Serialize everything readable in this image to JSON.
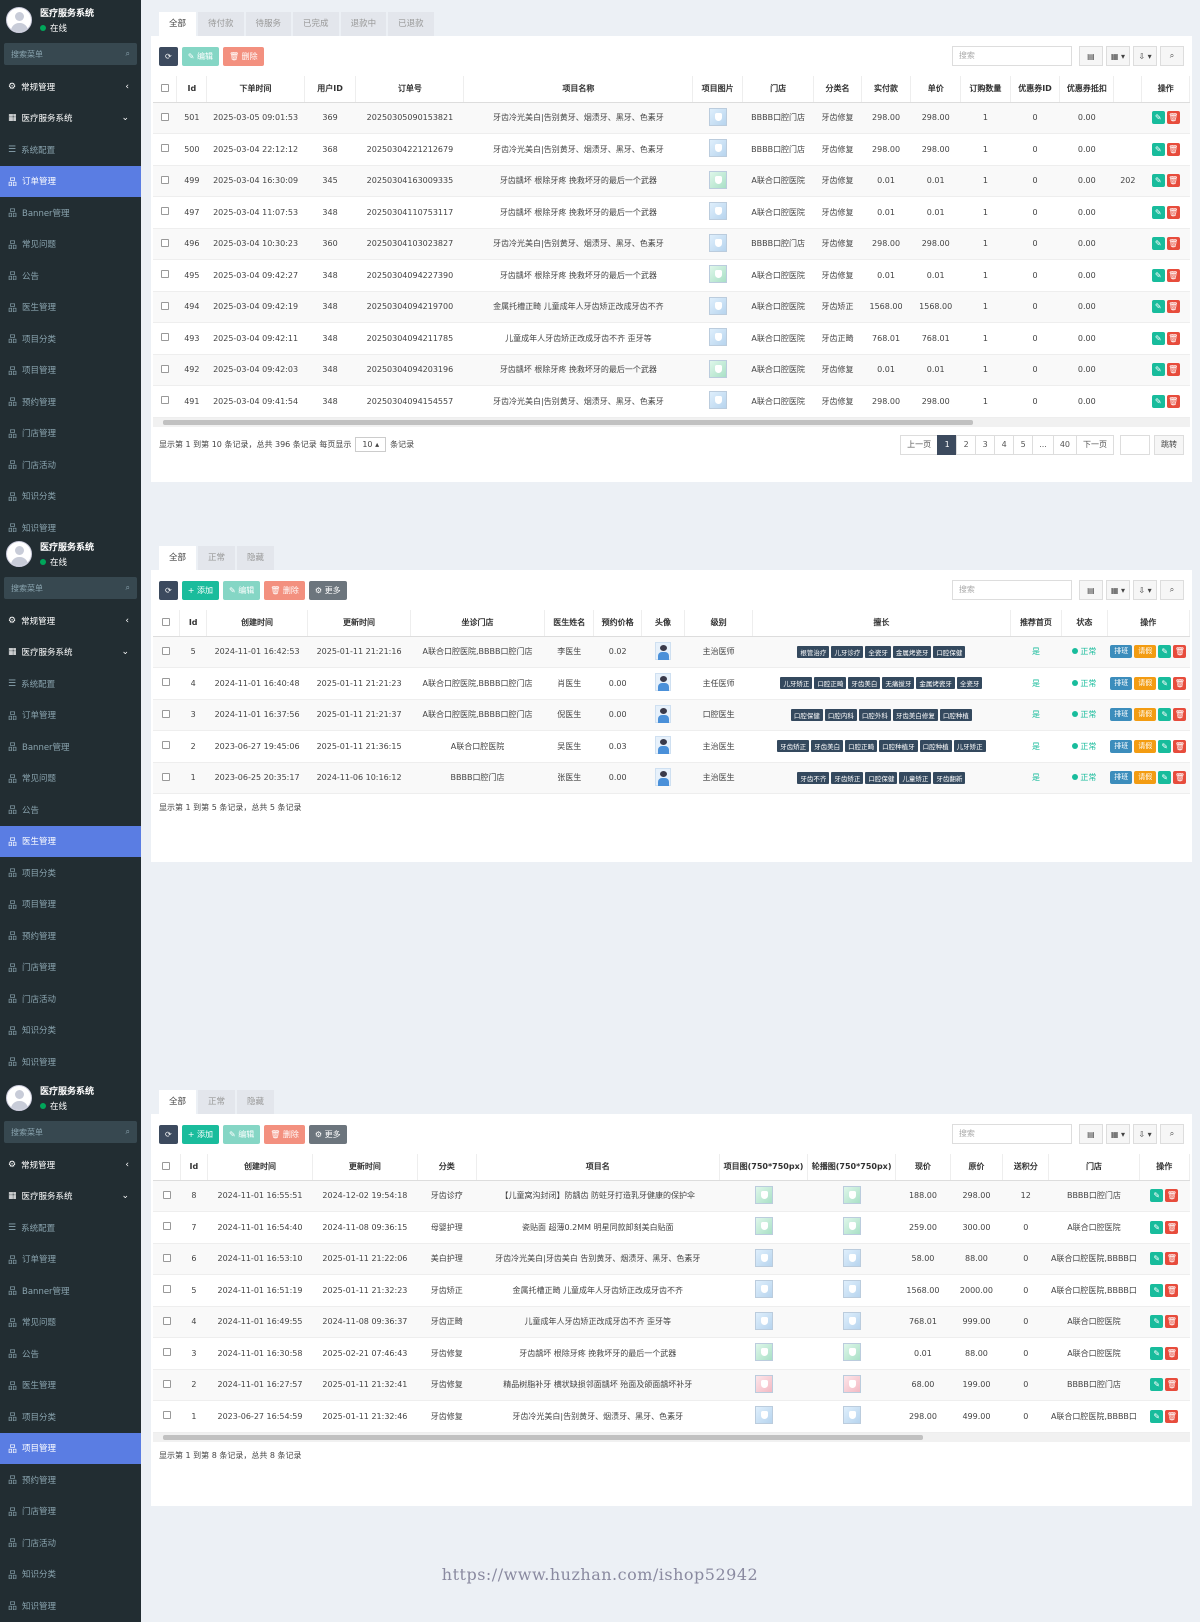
{
  "sidebar": {
    "user_name": "医疗服务系统",
    "user_status": "在线",
    "search_placeholder": "搜索菜单",
    "items": [
      {
        "label": "常规管理",
        "type": "top",
        "arrow": "‹"
      },
      {
        "label": "医疗服务系统",
        "type": "top",
        "arrow": "⌄"
      },
      {
        "label": "系统配置",
        "type": "sub"
      },
      {
        "label": "订单管理",
        "type": "sub"
      },
      {
        "label": "Banner管理",
        "type": "sub"
      },
      {
        "label": "常见问题",
        "type": "sub"
      },
      {
        "label": "公告",
        "type": "sub"
      },
      {
        "label": "医生管理",
        "type": "sub"
      },
      {
        "label": "项目分类",
        "type": "sub"
      },
      {
        "label": "项目管理",
        "type": "sub"
      },
      {
        "label": "预约管理",
        "type": "sub"
      },
      {
        "label": "门店管理",
        "type": "sub"
      },
      {
        "label": "门店活动",
        "type": "sub"
      },
      {
        "label": "知识分类",
        "type": "sub"
      },
      {
        "label": "知识管理",
        "type": "sub"
      }
    ]
  },
  "common": {
    "search_placeholder": "搜索",
    "btn_edit": "编辑",
    "btn_delete": "删除",
    "btn_add": "添加",
    "btn_more": "更多"
  },
  "orders": {
    "active_menu": 3,
    "tabs": [
      "全部",
      "待付款",
      "待服务",
      "已完成",
      "退款中",
      "已退款"
    ],
    "headers": [
      "Id",
      "下单时间",
      "用户ID",
      "订单号",
      "项目名称",
      "项目图片",
      "门店",
      "分类名",
      "实付款",
      "单价",
      "订购数量",
      "优惠券ID",
      "优惠券抵扣",
      "",
      "操作"
    ],
    "rows": [
      [
        "501",
        "2025-03-05 09:01:53",
        "369",
        "20250305090153821",
        "牙齿冷光美白|告别黄牙、烟渍牙、黑牙、色素牙",
        "BBBB口腔门店",
        "牙齿修复",
        "298.00",
        "298.00",
        "1",
        "0",
        "0.00",
        ""
      ],
      [
        "500",
        "2025-03-04 22:12:12",
        "368",
        "20250304221212679",
        "牙齿冷光美白|告别黄牙、烟渍牙、黑牙、色素牙",
        "BBBB口腔门店",
        "牙齿修复",
        "298.00",
        "298.00",
        "1",
        "0",
        "0.00",
        ""
      ],
      [
        "499",
        "2025-03-04 16:30:09",
        "345",
        "20250304163009335",
        "牙齿龋坏 根除牙疼 挽救坏牙的最后一个武器",
        "A联合口腔医院",
        "牙齿修复",
        "0.01",
        "0.01",
        "1",
        "0",
        "0.00",
        "202"
      ],
      [
        "497",
        "2025-03-04 11:07:53",
        "348",
        "20250304110753117",
        "牙齿龋坏 根除牙疼 挽救坏牙的最后一个武器",
        "A联合口腔医院",
        "牙齿修复",
        "0.01",
        "0.01",
        "1",
        "0",
        "0.00",
        ""
      ],
      [
        "496",
        "2025-03-04 10:30:23",
        "360",
        "20250304103023827",
        "牙齿冷光美白|告别黄牙、烟渍牙、黑牙、色素牙",
        "BBBB口腔门店",
        "牙齿修复",
        "298.00",
        "298.00",
        "1",
        "0",
        "0.00",
        ""
      ],
      [
        "495",
        "2025-03-04 09:42:27",
        "348",
        "20250304094227390",
        "牙齿龋坏 根除牙疼 挽救坏牙的最后一个武器",
        "A联合口腔医院",
        "牙齿修复",
        "0.01",
        "0.01",
        "1",
        "0",
        "0.00",
        ""
      ],
      [
        "494",
        "2025-03-04 09:42:19",
        "348",
        "20250304094219700",
        "金属托槽正畸 儿童成年人牙齿矫正改成牙齿不齐",
        "A联合口腔医院",
        "牙齿矫正",
        "1568.00",
        "1568.00",
        "1",
        "0",
        "0.00",
        ""
      ],
      [
        "493",
        "2025-03-04 09:42:11",
        "348",
        "20250304094211785",
        "儿童成年人牙齿矫正改成牙齿不齐 歪牙等",
        "A联合口腔医院",
        "牙齿正畸",
        "768.01",
        "768.01",
        "1",
        "0",
        "0.00",
        ""
      ],
      [
        "492",
        "2025-03-04 09:42:03",
        "348",
        "20250304094203196",
        "牙齿龋坏 根除牙疼 挽救坏牙的最后一个武器",
        "A联合口腔医院",
        "牙齿修复",
        "0.01",
        "0.01",
        "1",
        "0",
        "0.00",
        ""
      ],
      [
        "491",
        "2025-03-04 09:41:54",
        "348",
        "20250304094154557",
        "牙齿冷光美白|告别黄牙、烟渍牙、黑牙、色素牙",
        "A联合口腔医院",
        "牙齿修复",
        "298.00",
        "298.00",
        "1",
        "0",
        "0.00",
        ""
      ]
    ],
    "pager_info": "显示第 1 到第 10 条记录，总共 396 条记录 每页显示",
    "page_size": "10",
    "page_size_suffix": "条记录",
    "prev": "上一页",
    "pages": [
      "1",
      "2",
      "3",
      "4",
      "5",
      "...",
      "40"
    ],
    "next": "下一页",
    "jump": "跳转"
  },
  "doctors": {
    "active_menu": 7,
    "tabs": [
      "全部",
      "正常",
      "隐藏"
    ],
    "headers": [
      "Id",
      "创建时间",
      "更新时间",
      "坐诊门店",
      "医生姓名",
      "预约价格",
      "头像",
      "级别",
      "擅长",
      "推荐首页",
      "状态",
      "操作"
    ],
    "rows": [
      {
        "id": "5",
        "created": "2024-11-01 16:42:53",
        "updated": "2025-01-11 21:21:16",
        "store": "A联合口腔医院,BBBB口腔门店",
        "name": "李医生",
        "price": "0.02",
        "level": "主治医师",
        "tags": [
          "根管治疗",
          "儿牙诊疗",
          "全瓷牙",
          "金属烤瓷牙",
          "口腔保健"
        ],
        "recommend": "是",
        "status": "正常"
      },
      {
        "id": "4",
        "created": "2024-11-01 16:40:48",
        "updated": "2025-01-11 21:21:23",
        "store": "A联合口腔医院,BBBB口腔门店",
        "name": "肖医生",
        "price": "0.00",
        "level": "主任医师",
        "tags": [
          "儿牙矫正",
          "口腔正畸",
          "牙齿美白",
          "无痛拔牙",
          "金属烤瓷牙",
          "全瓷牙"
        ],
        "recommend": "是",
        "status": "正常"
      },
      {
        "id": "3",
        "created": "2024-11-01 16:37:56",
        "updated": "2025-01-11 21:21:37",
        "store": "A联合口腔医院,BBBB口腔门店",
        "name": "倪医生",
        "price": "0.00",
        "level": "口腔医生",
        "tags": [
          "口腔保健",
          "口腔内科",
          "口腔外科",
          "牙齿美白修复",
          "口腔种植"
        ],
        "recommend": "是",
        "status": "正常"
      },
      {
        "id": "2",
        "created": "2023-06-27 19:45:06",
        "updated": "2025-01-11 21:36:15",
        "store": "A联合口腔医院",
        "name": "吴医生",
        "price": "0.03",
        "level": "主治医生",
        "tags": [
          "牙齿矫正",
          "牙齿美白",
          "口腔正畸",
          "口腔种植牙",
          "口腔种植",
          "儿牙矫正"
        ],
        "recommend": "是",
        "status": "正常"
      },
      {
        "id": "1",
        "created": "2023-06-25 20:35:17",
        "updated": "2024-11-06 10:16:12",
        "store": "BBBB口腔门店",
        "name": "张医生",
        "price": "0.00",
        "level": "主治医生",
        "tags": [
          "牙齿不齐",
          "牙齿矫正",
          "口腔保健",
          "儿童矫正",
          "牙齿翻新"
        ],
        "recommend": "是",
        "status": "正常"
      }
    ],
    "btn_schedule": "排班",
    "btn_leave": "请假",
    "pager_info": "显示第 1 到第 5 条记录，总共 5 条记录"
  },
  "projects": {
    "active_menu": 9,
    "tabs": [
      "全部",
      "正常",
      "隐藏"
    ],
    "headers": [
      "Id",
      "创建时间",
      "更新时间",
      "分类",
      "项目名",
      "项目图(750*750px)",
      "轮播图(750*750px)",
      "现价",
      "原价",
      "送积分",
      "门店",
      "操作"
    ],
    "rows": [
      [
        "8",
        "2024-11-01 16:55:51",
        "2024-12-02 19:54:18",
        "牙齿诊疗",
        "【儿童窝沟封闭】防龋齿 防蛀牙打造乳牙健康的保护伞",
        "188.00",
        "298.00",
        "12",
        "BBBB口腔门店"
      ],
      [
        "7",
        "2024-11-01 16:54:40",
        "2024-11-08 09:36:15",
        "母婴护理",
        "瓷贴面 超薄0.2MM 明星同款卸刻美白贴面",
        "259.00",
        "300.00",
        "0",
        "A联合口腔医院"
      ],
      [
        "6",
        "2024-11-01 16:53:10",
        "2025-01-11 21:22:06",
        "美白护理",
        "牙齿冷光美白|牙齿美白 告别黄牙、烟渍牙、黑牙、色素牙",
        "58.00",
        "88.00",
        "0",
        "A联合口腔医院,BBBB口"
      ],
      [
        "5",
        "2024-11-01 16:51:19",
        "2025-01-11 21:32:23",
        "牙齿矫正",
        "金属托槽正畸 儿童成年人牙齿矫正改成牙齿不齐",
        "1568.00",
        "2000.00",
        "0",
        "A联合口腔医院,BBBB口"
      ],
      [
        "4",
        "2024-11-01 16:49:55",
        "2024-11-08 09:36:37",
        "牙齿正畸",
        "儿童成年人牙齿矫正改成牙齿不齐 歪牙等",
        "768.01",
        "999.00",
        "0",
        "A联合口腔医院"
      ],
      [
        "3",
        "2024-11-01 16:30:58",
        "2025-02-21 07:46:43",
        "牙齿修复",
        "牙齿龋坏 根除牙疼 挽救坏牙的最后一个武器",
        "0.01",
        "88.00",
        "0",
        "A联合口腔医院"
      ],
      [
        "2",
        "2024-11-01 16:27:57",
        "2025-01-11 21:32:41",
        "牙齿修复",
        "精品树脂补牙 横状缺损邻面龋坏 殆面及颌面龋坏补牙",
        "68.00",
        "199.00",
        "0",
        "BBBB口腔门店"
      ],
      [
        "1",
        "2023-06-27 16:54:59",
        "2025-01-11 21:32:46",
        "牙齿修复",
        "牙齿冷光美白|告别黄牙、烟渍牙、黑牙、色素牙",
        "298.00",
        "499.00",
        "0",
        "A联合口腔医院,BBBB口"
      ]
    ],
    "pager_info": "显示第 1 到第 8 条记录，总共 8 条记录"
  },
  "footer_url": "https://www.huzhan.com/ishop52942"
}
